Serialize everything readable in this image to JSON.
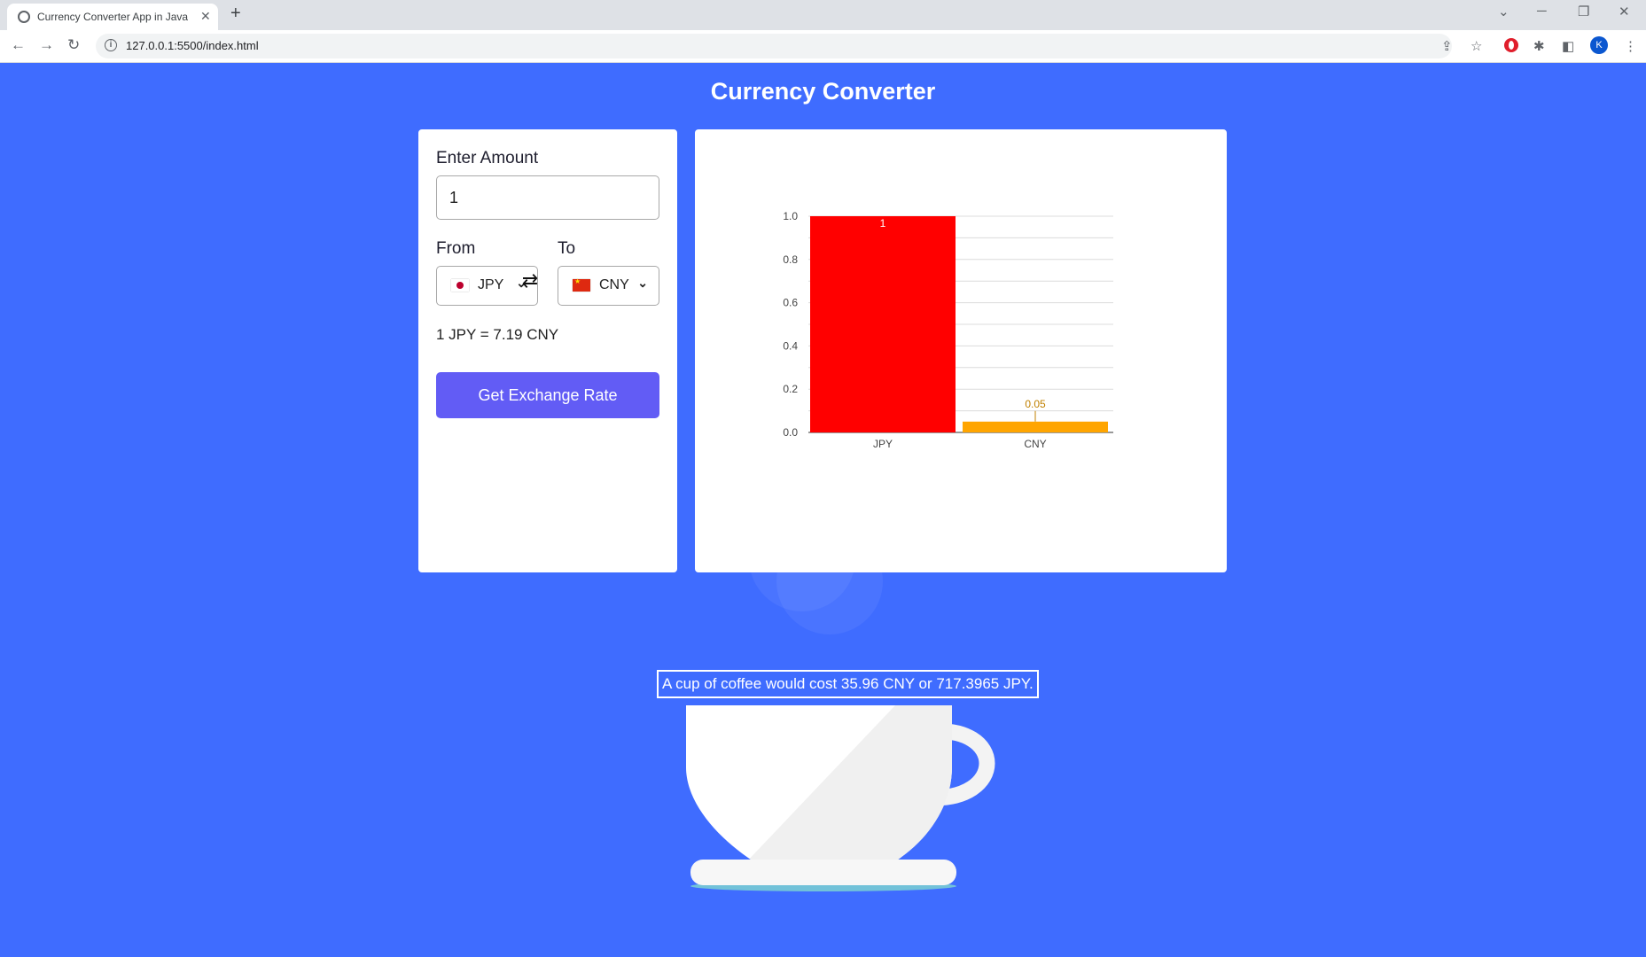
{
  "browser": {
    "tab_title": "Currency Converter App in JavaScript",
    "url": "127.0.0.1:5500/index.html",
    "profile_initial": "K"
  },
  "app": {
    "title": "Currency Converter",
    "amount_label": "Enter Amount",
    "amount_value": "1",
    "from_label": "From",
    "to_label": "To",
    "from_currency": "JPY",
    "to_currency": "CNY",
    "rate_text": "1 JPY = 7.19 CNY",
    "button_label": "Get Exchange Rate",
    "coffee_text": "A cup of coffee would cost 35.96 CNY or 717.3965 JPY.",
    "colors": {
      "background": "#3f6cff",
      "button": "#625cf5",
      "bar_jpy": "#ff0000",
      "bar_cny": "#ffa500"
    }
  },
  "chart_data": {
    "type": "bar",
    "categories": [
      "JPY",
      "CNY"
    ],
    "values": [
      1,
      0.05
    ],
    "data_labels": [
      "1",
      "0.05"
    ],
    "colors": [
      "#ff0000",
      "#ffa500"
    ],
    "ylim": [
      0,
      1.0
    ],
    "y_ticks": [
      "0.0",
      "0.2",
      "0.4",
      "0.6",
      "0.8",
      "1.0"
    ],
    "grid": true,
    "title": "",
    "xlabel": "",
    "ylabel": ""
  }
}
